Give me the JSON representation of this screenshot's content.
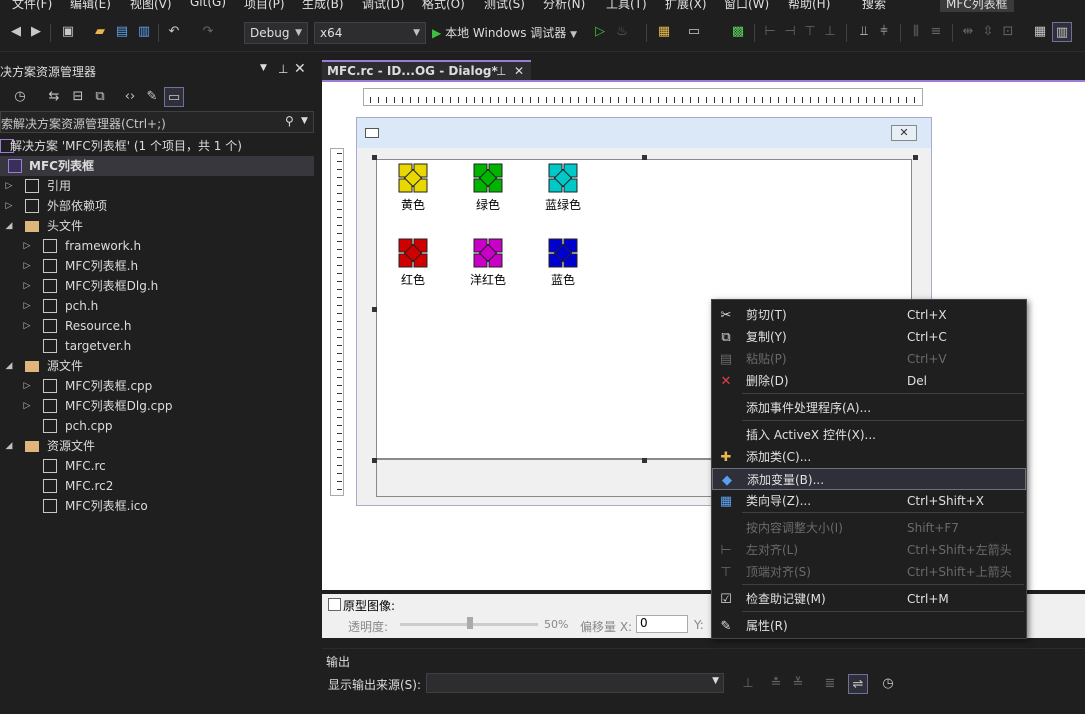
{
  "menubar": {
    "items": [
      "文件(F)",
      "编辑(E)",
      "视图(V)",
      "Git(G)",
      "项目(P)",
      "生成(B)",
      "调试(D)",
      "格式(O)",
      "测试(S)",
      "分析(N)",
      "工具(T)",
      "扩展(X)",
      "窗口(W)",
      "帮助(H)"
    ],
    "search_label": "搜索",
    "solution_badge": "MFC列表框"
  },
  "toolbar": {
    "config": "Debug",
    "platform": "x64",
    "run_label": "本地 Windows 调试器"
  },
  "solution_explorer": {
    "title": "决方案资源管理器",
    "search_placeholder": "索解决方案资源管理器(Ctrl+;)",
    "solution_label": "解决方案 'MFC列表框' (1 个项目，共 1 个)",
    "project_label": "MFC列表框",
    "nodes": [
      {
        "label": "引用",
        "icon": "references-icon"
      },
      {
        "label": "外部依赖项",
        "icon": "external-deps-icon"
      },
      {
        "label": "头文件",
        "icon": "folder-icon"
      },
      {
        "label": "framework.h",
        "icon": "header-file-icon"
      },
      {
        "label": "MFC列表框.h",
        "icon": "header-file-icon"
      },
      {
        "label": "MFC列表框Dlg.h",
        "icon": "header-file-icon"
      },
      {
        "label": "pch.h",
        "icon": "header-file-icon"
      },
      {
        "label": "Resource.h",
        "icon": "header-file-icon"
      },
      {
        "label": "targetver.h",
        "icon": "header-file-icon"
      },
      {
        "label": "源文件",
        "icon": "folder-icon"
      },
      {
        "label": "MFC列表框.cpp",
        "icon": "cpp-file-icon"
      },
      {
        "label": "MFC列表框Dlg.cpp",
        "icon": "cpp-file-icon"
      },
      {
        "label": "pch.cpp",
        "icon": "cpp-file-icon"
      },
      {
        "label": "资源文件",
        "icon": "folder-icon"
      },
      {
        "label": "MFC.rc",
        "icon": "rc-file-icon"
      },
      {
        "label": "MFC.rc2",
        "icon": "rc-file-icon"
      },
      {
        "label": "MFC列表框.ico",
        "icon": "ico-file-icon"
      }
    ]
  },
  "editor": {
    "tab_label": "MFC.rc - ID...OG - Dialog*"
  },
  "list_items": [
    {
      "label": "黄色",
      "color": "#e8d800"
    },
    {
      "label": "绿色",
      "color": "#00b400"
    },
    {
      "label": "蓝绿色",
      "color": "#00c8c8"
    },
    {
      "label": "红色",
      "color": "#d00000"
    },
    {
      "label": "洋红色",
      "color": "#c800c8"
    },
    {
      "label": "蓝色",
      "color": "#0000d0"
    }
  ],
  "context_menu": [
    {
      "label": "剪切(T)",
      "shortcut": "Ctrl+X",
      "icon": "cut-icon",
      "enabled": true
    },
    {
      "label": "复制(Y)",
      "shortcut": "Ctrl+C",
      "icon": "copy-icon",
      "enabled": true
    },
    {
      "label": "粘贴(P)",
      "shortcut": "Ctrl+V",
      "icon": "paste-icon",
      "enabled": false
    },
    {
      "label": "删除(D)",
      "shortcut": "Del",
      "icon": "delete-icon",
      "enabled": true
    },
    {
      "label": "添加事件处理程序(A)...",
      "shortcut": "",
      "icon": "",
      "enabled": true
    },
    {
      "label": "插入 ActiveX 控件(X)...",
      "shortcut": "",
      "icon": "",
      "enabled": true
    },
    {
      "label": "添加类(C)...",
      "shortcut": "",
      "icon": "add-class-icon",
      "enabled": true
    },
    {
      "label": "添加变量(B)...",
      "shortcut": "",
      "icon": "add-variable-icon",
      "enabled": true
    },
    {
      "label": "类向导(Z)...",
      "shortcut": "Ctrl+Shift+X",
      "icon": "class-wizard-icon",
      "enabled": true
    },
    {
      "label": "按内容调整大小(I)",
      "shortcut": "Shift+F7",
      "icon": "",
      "enabled": false
    },
    {
      "label": "左对齐(L)",
      "shortcut": "Ctrl+Shift+左箭头",
      "icon": "align-left-icon",
      "enabled": false
    },
    {
      "label": "顶端对齐(S)",
      "shortcut": "Ctrl+Shift+上箭头",
      "icon": "align-top-icon",
      "enabled": false
    },
    {
      "label": "检查助记键(M)",
      "shortcut": "Ctrl+M",
      "icon": "check-mnemonic-icon",
      "enabled": true
    },
    {
      "label": "属性(R)",
      "shortcut": "",
      "icon": "properties-icon",
      "enabled": true
    }
  ],
  "prototype": {
    "label": "原型图像:",
    "opacity_label": "透明度:",
    "opacity_value": "50%",
    "offset_label": "偏移量 X:",
    "offset_x": "0",
    "y_label": "Y:"
  },
  "output": {
    "title": "输出",
    "source_label": "显示输出来源(S):"
  }
}
